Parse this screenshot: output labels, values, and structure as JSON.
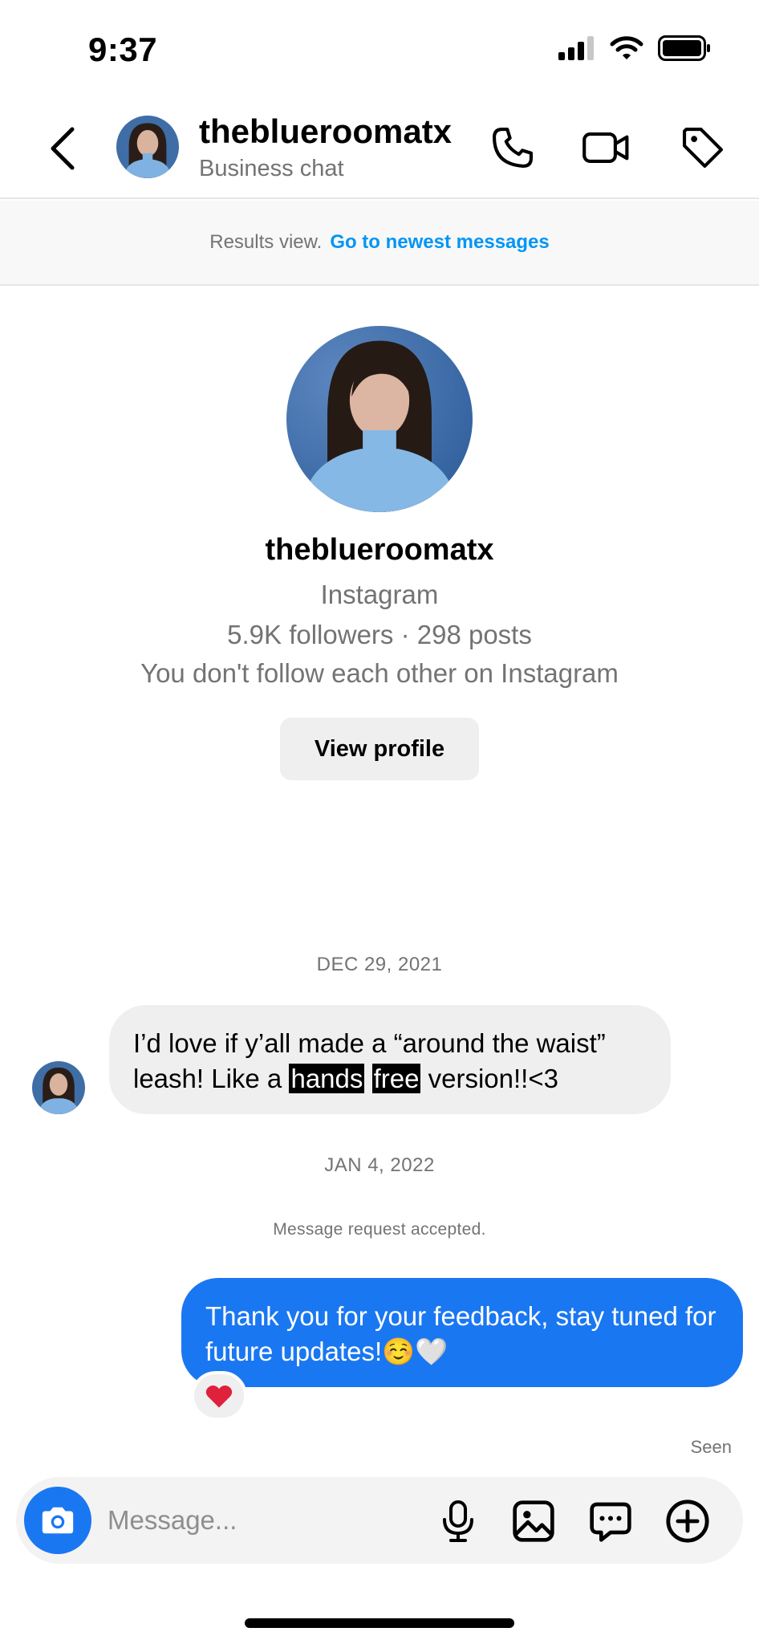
{
  "status_bar": {
    "time": "9:37"
  },
  "header": {
    "username": "theblueroomatx",
    "subtitle": "Business chat"
  },
  "results_banner": {
    "text": "Results view.",
    "link": "Go to newest messages"
  },
  "profile": {
    "username": "theblueroomatx",
    "platform": "Instagram",
    "stats": "5.9K followers · 298 posts",
    "relationship": "You don't follow each other on Instagram",
    "view_button": "View profile"
  },
  "conversation": {
    "date_1": "DEC 29, 2021",
    "incoming_message": {
      "before": "I’d love if y’all made a “around the waist” leash! Like a ",
      "highlight_1": "hands",
      "highlight_2": "free",
      "after": " version!!<3"
    },
    "date_2": "JAN 4, 2022",
    "system_message": "Message request accepted.",
    "outgoing_message": "Thank you for your feedback, stay tuned for future updates!☺️🤍",
    "reaction": "❤️",
    "seen": "Seen"
  },
  "composer": {
    "placeholder": "Message..."
  },
  "icons": {
    "back": "chevron-left-icon",
    "call": "phone-icon",
    "video": "video-camera-icon",
    "tag": "tag-icon",
    "camera": "camera-icon",
    "mic": "microphone-icon",
    "gallery": "image-icon",
    "sticker": "chat-bubble-icon",
    "add": "plus-circle-icon"
  },
  "colors": {
    "accent": "#1a77f2",
    "link": "#0095f6",
    "muted": "#737373",
    "bubble_incoming": "#efefef"
  }
}
